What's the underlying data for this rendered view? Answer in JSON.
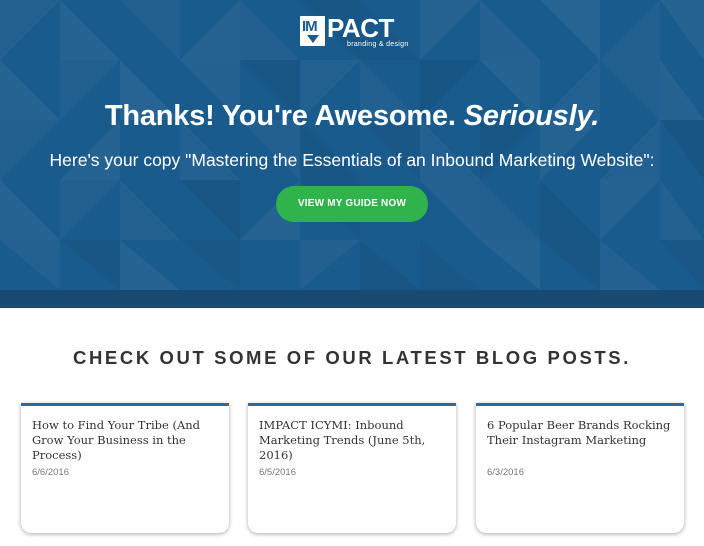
{
  "brand": {
    "logo_mark": "IM",
    "logo_word": "PACT",
    "tagline": "branding & design"
  },
  "hero": {
    "headline_main": "Thanks! You're Awesome. ",
    "headline_emphasis": "Seriously.",
    "subhead": "Here's your copy \"Mastering the Essentials of an Inbound Marketing Website\":",
    "cta_label": "VIEW MY GUIDE NOW"
  },
  "blog": {
    "heading": "CHECK OUT SOME OF OUR LATEST BLOG POSTS.",
    "posts": [
      {
        "title": "How to Find Your Tribe (And Grow Your Business in the Process)",
        "date": "6/6/2016"
      },
      {
        "title": "IMPACT ICYMI: Inbound Marketing Trends (June 5th, 2016)",
        "date": "6/5/2016"
      },
      {
        "title": "6 Popular Beer Brands Rocking Their Instagram Marketing",
        "date": "6/3/2016"
      }
    ]
  },
  "colors": {
    "hero_bg": "#1a5b8e",
    "cta_green": "#2fb34a",
    "card_accent": "#2b6b9f"
  }
}
